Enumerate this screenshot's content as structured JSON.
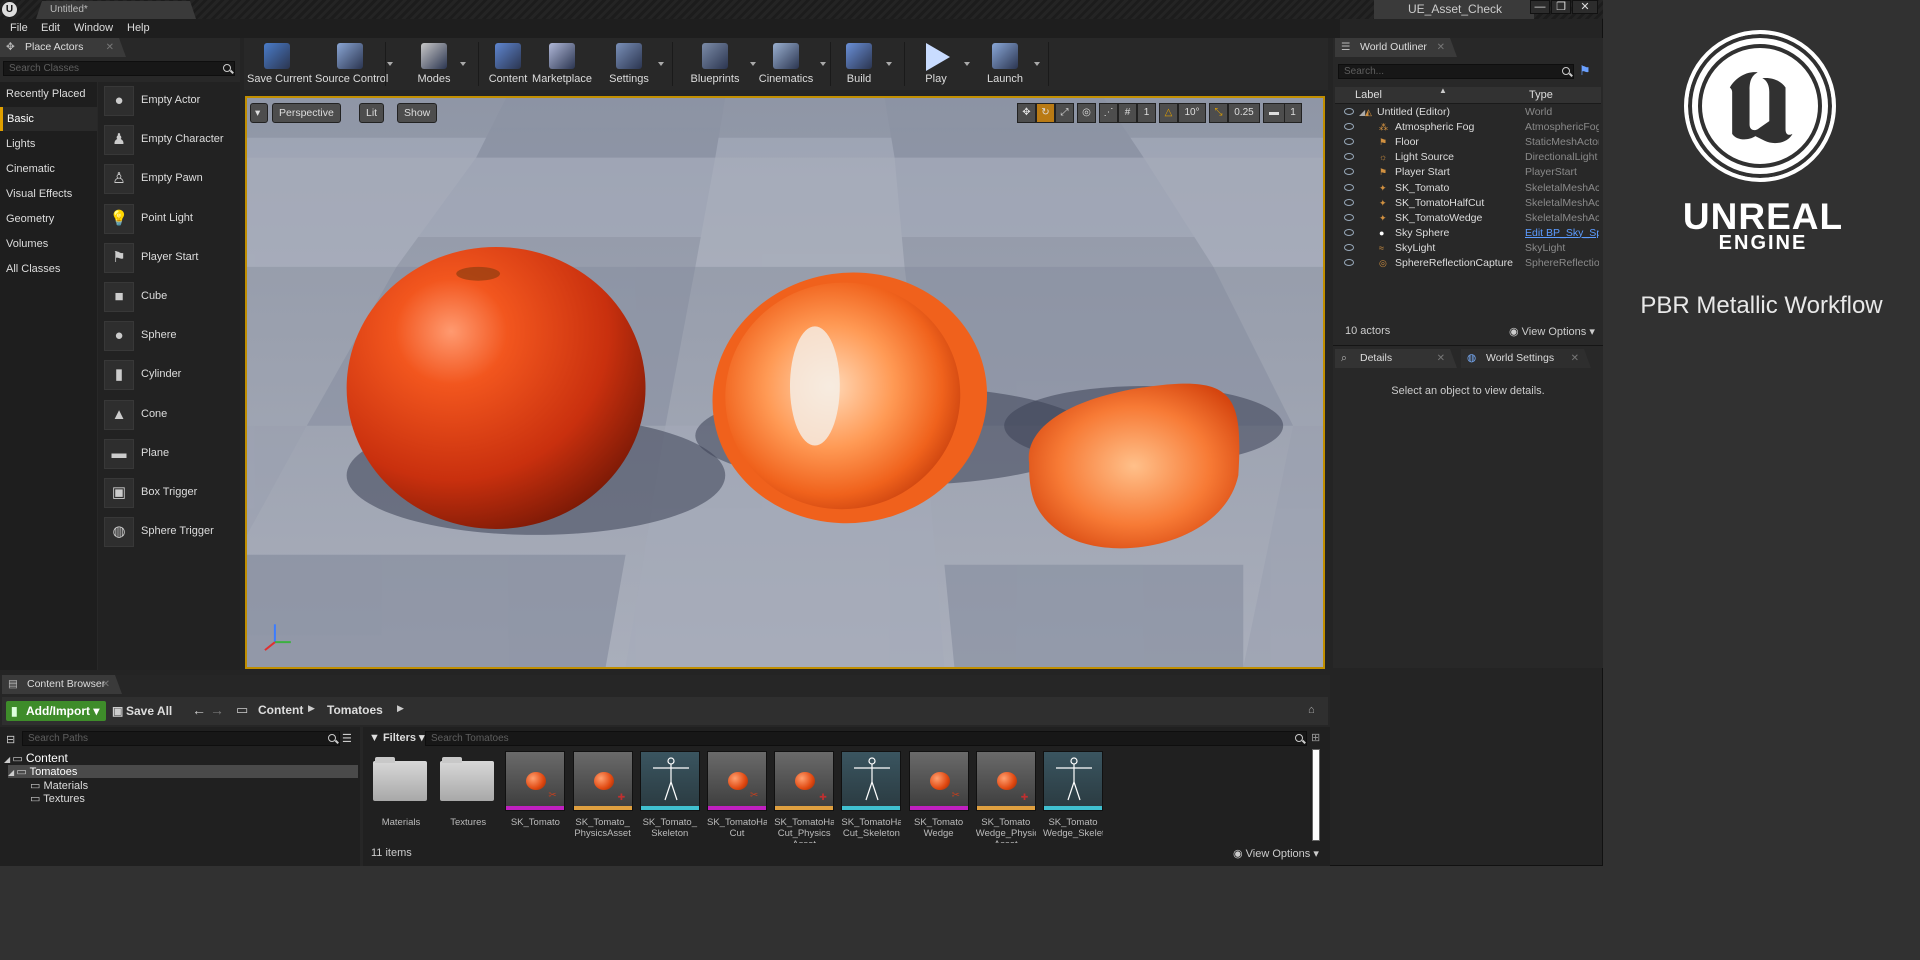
{
  "window": {
    "doc_tab": "Untitled*",
    "project_name": "UE_Asset_Check",
    "buttons": [
      "—",
      "❐",
      "✕"
    ]
  },
  "menu": [
    "File",
    "Edit",
    "Window",
    "Help"
  ],
  "place_actors": {
    "tab": "Place Actors",
    "search_placeholder": "Search Classes",
    "categories": [
      "Recently Placed",
      "Basic",
      "Lights",
      "Cinematic",
      "Visual Effects",
      "Geometry",
      "Volumes",
      "All Classes"
    ],
    "selected_category": "Basic",
    "actors": [
      "Empty Actor",
      "Empty Character",
      "Empty Pawn",
      "Point Light",
      "Player Start",
      "Cube",
      "Sphere",
      "Cylinder",
      "Cone",
      "Plane",
      "Box Trigger",
      "Sphere Trigger"
    ]
  },
  "toolbar": {
    "buttons": [
      "Save Current",
      "Source Control",
      "Modes",
      "Content",
      "Marketplace",
      "Settings",
      "Blueprints",
      "Cinematics",
      "Build",
      "Play",
      "Launch"
    ]
  },
  "viewport": {
    "view_mode": "Perspective",
    "lighting": "Lit",
    "show": "Show",
    "rotation_snap": "10°",
    "scale_snap": "0.25",
    "camera_speed": "1",
    "grid_snap": "1"
  },
  "outliner": {
    "tab": "World Outliner",
    "search_placeholder": "Search...",
    "col_label": "Label",
    "col_type": "Type",
    "rows": [
      {
        "label": "Untitled (Editor)",
        "type": "World"
      },
      {
        "label": "Atmospheric Fog",
        "type": "AtmosphericFog"
      },
      {
        "label": "Floor",
        "type": "StaticMeshActor"
      },
      {
        "label": "Light Source",
        "type": "DirectionalLight"
      },
      {
        "label": "Player Start",
        "type": "PlayerStart"
      },
      {
        "label": "SK_Tomato",
        "type": "SkeletalMeshActor"
      },
      {
        "label": "SK_TomatoHalfCut",
        "type": "SkeletalMeshActor"
      },
      {
        "label": "SK_TomatoWedge",
        "type": "SkeletalMeshActor"
      },
      {
        "label": "Sky Sphere",
        "type": "Edit BP_Sky_Sphere"
      },
      {
        "label": "SkyLight",
        "type": "SkyLight"
      },
      {
        "label": "SphereReflectionCapture",
        "type": "SphereReflectionCapture"
      }
    ],
    "actor_count": "10 actors",
    "view_options": "View Options"
  },
  "details": {
    "tab_details": "Details",
    "tab_world_settings": "World Settings",
    "empty_message": "Select an object to view details."
  },
  "content_browser": {
    "tab": "Content Browser",
    "add_import": "Add/Import",
    "save_all": "Save All",
    "breadcrumb": [
      "Content",
      "Tomatoes"
    ],
    "search_paths_placeholder": "Search Paths",
    "filters": "Filters",
    "search_assets_placeholder": "Search Tomatoes",
    "tree": [
      "Content",
      "Tomatoes",
      "Materials",
      "Textures"
    ],
    "assets": [
      {
        "name": "Materials",
        "kind": "folder"
      },
      {
        "name": "Textures",
        "kind": "folder"
      },
      {
        "name": "SK_Tomato",
        "kind": "mesh",
        "bar": "#c020c0"
      },
      {
        "name": "SK_Tomato_ PhysicsAsset",
        "kind": "physics",
        "bar": "#e0a040"
      },
      {
        "name": "SK_Tomato_ Skeleton",
        "kind": "skeleton",
        "bar": "#40c0d0"
      },
      {
        "name": "SK_TomatoHalf Cut",
        "kind": "mesh",
        "bar": "#c020c0"
      },
      {
        "name": "SK_TomatoHalf Cut_Physics Asset",
        "kind": "physics",
        "bar": "#e0a040"
      },
      {
        "name": "SK_TomatoHalf Cut_Skeleton",
        "kind": "skeleton",
        "bar": "#40c0d0"
      },
      {
        "name": "SK_Tomato Wedge",
        "kind": "mesh",
        "bar": "#c020c0"
      },
      {
        "name": "SK_Tomato Wedge_Physics Asset",
        "kind": "physics",
        "bar": "#e0a040"
      },
      {
        "name": "SK_Tomato Wedge_Skeleton",
        "kind": "skeleton",
        "bar": "#40c0d0"
      }
    ],
    "item_count": "11 items",
    "view_options": "View Options"
  },
  "brand": {
    "title": "UNREAL",
    "subtitle": "ENGINE",
    "caption": "PBR Metallic Workflow"
  }
}
